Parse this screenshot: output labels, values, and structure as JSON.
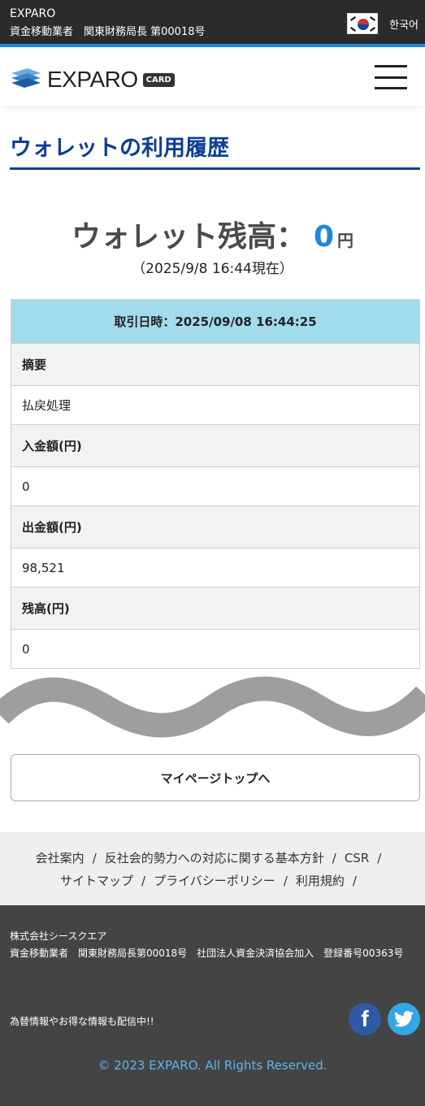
{
  "topbar": {
    "brand": "EXPARO",
    "registration": "資金移動業者　関東財務局長 第00018号",
    "language_label": "한국어",
    "flag_icon": "korea-flag-icon"
  },
  "header": {
    "logo_text": "EXPARO",
    "logo_badge": "CARD",
    "menu_icon": "hamburger-menu-icon"
  },
  "page": {
    "title": "ウォレットの利用履歴",
    "balance_label": "ウォレット残高：",
    "balance_value": "0",
    "balance_unit": "円",
    "as_of": "（2025/9/8 16:44現在）"
  },
  "history": {
    "header": "取引日時：2025/09/08 16:44:25",
    "rows": [
      {
        "label": "摘要",
        "value": "払戻処理"
      },
      {
        "label": "入金額(円)",
        "value": "0"
      },
      {
        "label": "出金額(円)",
        "value": "98,521"
      },
      {
        "label": "残高(円)",
        "value": "0"
      }
    ]
  },
  "mypage_button": "マイページトップへ",
  "footer_links": [
    "会社案内",
    "反社会的勢力への対応に関する基本方針",
    "CSR",
    "サイトマップ",
    "プライバシーポリシー",
    "利用規約"
  ],
  "footer": {
    "company_name": "株式会社シースクエア",
    "company_info": "資金移動業者　関東財務局長第00018号　社団法人資金決済協会加入　登録番号00363号",
    "news": "為替情報やお得な情報も配信中!!",
    "copyright": "© 2023 EXPARO. All Rights Reserved.",
    "colors": {
      "background": "#444444",
      "copyright": "#5eb5ea",
      "facebook": "#2f5aa6",
      "twitter": "#34a6e6"
    }
  },
  "colors": {
    "accent_blue": "#1e88d6",
    "title_navy": "#0d3f91",
    "table_header": "#a2dcec"
  }
}
